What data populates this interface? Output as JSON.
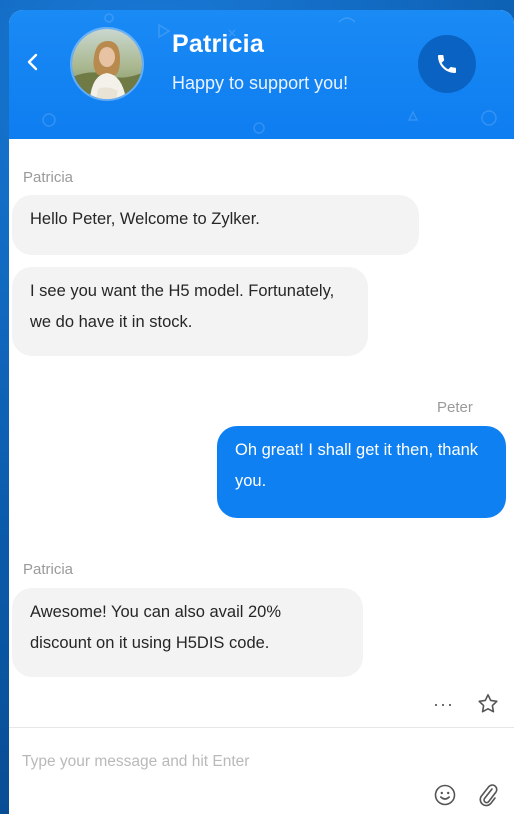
{
  "header": {
    "agent_name": "Patricia",
    "agent_status": "Happy to support you!"
  },
  "messages": [
    {
      "sender": "Patricia",
      "direction": "incoming",
      "text": "Hello Peter, Welcome to Zylker."
    },
    {
      "sender": "",
      "direction": "incoming",
      "text": "I see you want the H5 model. Fortunately, we do have it in stock."
    },
    {
      "sender": "Peter",
      "direction": "outgoing",
      "text": "Oh great! I shall get it then, thank you."
    },
    {
      "sender": "Patricia",
      "direction": "incoming",
      "text": "Awesome! You can also avail 20% discount on it using H5DIS code."
    }
  ],
  "actions": {
    "more_label": "···"
  },
  "composer": {
    "placeholder": "Type your message and hit Enter",
    "value": ""
  },
  "icons": {
    "back": "chevron-left-icon",
    "call": "phone-icon",
    "more": "ellipsis-icon",
    "star": "star-icon",
    "emoji": "smiley-icon",
    "attach": "paperclip-icon"
  },
  "colors": {
    "header": "#0e7df0",
    "outgoing_bubble": "#0e80f2",
    "incoming_bubble": "#f3f3f3",
    "call_button": "#0a63c2"
  }
}
